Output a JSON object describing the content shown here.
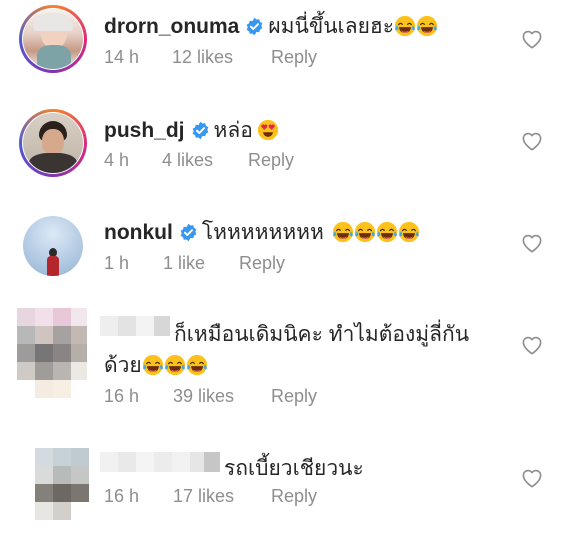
{
  "comments": [
    {
      "username": "drorn_onuma",
      "verified": true,
      "text": "ผมนี่ขึ้นเลยฮะ",
      "emoji_name": "face-with-tears-of-joy-emoji",
      "time": "14 h",
      "likes": "12 likes",
      "reply": "Reply"
    },
    {
      "username": "push_dj",
      "verified": true,
      "text": "หล่อ",
      "emoji_name": "heart-eyes-emoji",
      "time": "4 h",
      "likes": "4 likes",
      "reply": "Reply"
    },
    {
      "username": "nonkul",
      "verified": true,
      "text": "โหหหหหหหห",
      "emoji_name": "face-with-tears-of-joy-emoji",
      "time": "1 h",
      "likes": "1 like",
      "reply": "Reply"
    },
    {
      "username": "",
      "verified": false,
      "text": "ก็เหมือนเดิมนิคะ ทำไมต้องมู่ลี่กัน",
      "text2": "ด้วย",
      "emoji_name": "face-with-tears-of-joy-emoji",
      "time": "16 h",
      "likes": "39 likes",
      "reply": "Reply"
    },
    {
      "username": "",
      "verified": false,
      "text": "รถเบี้ยวเชียวนะ",
      "time": "16 h",
      "likes": "17 likes",
      "reply": "Reply"
    }
  ],
  "colors": {
    "verified": "#3897f0",
    "meta": "#8e8e8e",
    "text": "#262626"
  }
}
